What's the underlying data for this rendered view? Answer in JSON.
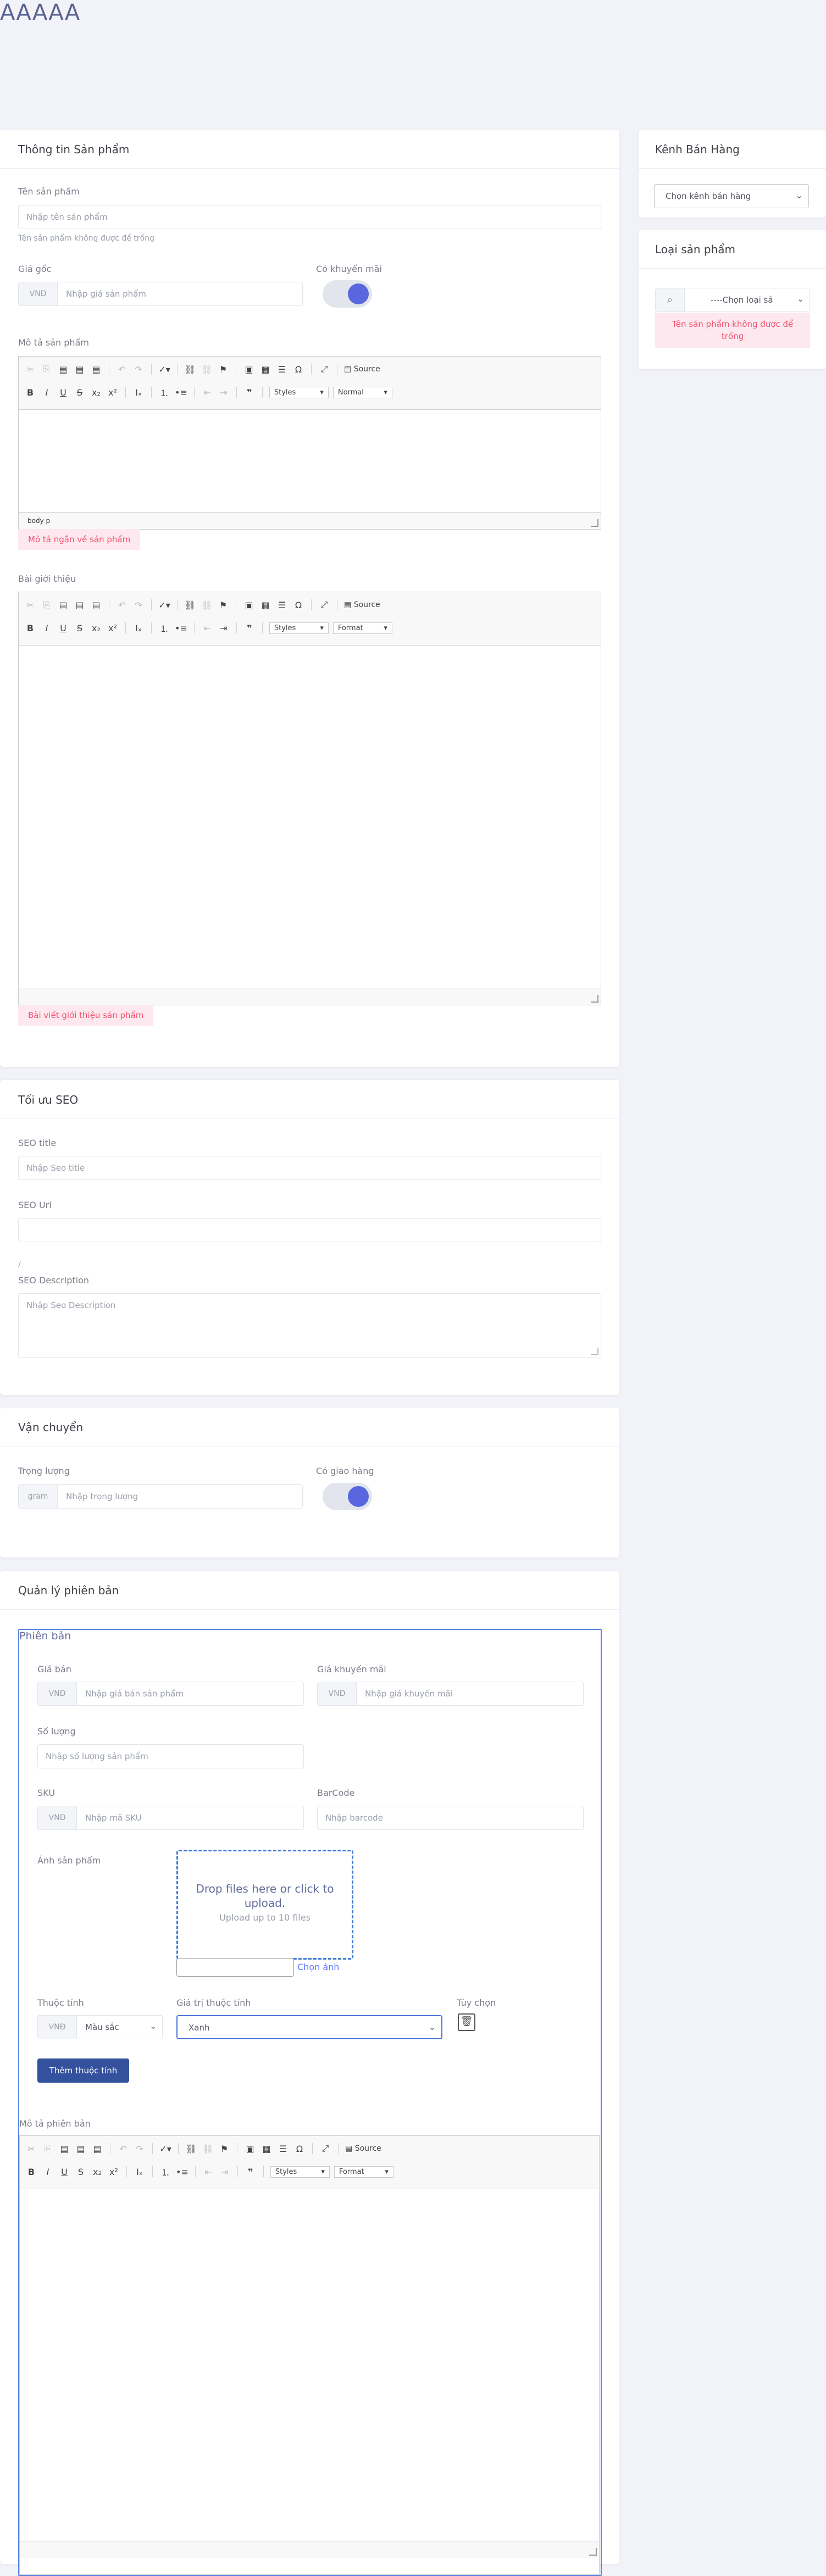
{
  "page": {
    "title": "AAAAA"
  },
  "product_info": {
    "title": "Thông tin Sản phẩm",
    "name_label": "Tên sản phẩm",
    "name_placeholder": "Nhập tên sản phẩm",
    "name_hint": "Tên sản phẩm không được để trống",
    "price_label": "Giá gốc",
    "price_prefix": "VNĐ",
    "price_placeholder": "Nhập giá sản phẩm",
    "promo_label": "Có khuyến mãi",
    "promo_enabled": true,
    "desc_label": "Mô tả sản phẩm",
    "desc_error": "Mô tả ngắn về sản phẩm",
    "desc_path": "body  p",
    "intro_label": "Bài giới thiệu",
    "intro_error": "Bài viết giới thiệu sản phẩm"
  },
  "editor_toolbar": {
    "styles": "Styles",
    "normal": "Normal",
    "format": "Format",
    "source": "Source",
    "row1_icons": [
      "cut-icon",
      "copy-icon",
      "paste-icon",
      "paste-text-icon",
      "paste-word-icon",
      "undo-icon",
      "redo-icon",
      "spellcheck-icon",
      "link-icon",
      "unlink-icon",
      "anchor-icon",
      "image-icon",
      "table-icon",
      "hr-icon",
      "special-char-icon",
      "maximize-icon",
      "source-icon"
    ],
    "row2_icons": [
      "bold-icon",
      "italic-icon",
      "underline-icon",
      "strike-icon",
      "subscript-icon",
      "superscript-icon",
      "remove-format-icon",
      "numbered-list-icon",
      "bulleted-list-icon",
      "outdent-icon",
      "indent-icon",
      "blockquote-icon"
    ]
  },
  "seo": {
    "title": "Tối ưu SEO",
    "seo_title_label": "SEO title",
    "seo_title_placeholder": "Nhập Seo title",
    "seo_url_label": "SEO Url",
    "seo_url_value": "",
    "seo_url_slash": "/",
    "seo_desc_label": "SEO Description",
    "seo_desc_placeholder": "Nhập Seo Description"
  },
  "shipping": {
    "title": "Vận chuyển",
    "weight_label": "Trọng lượng",
    "weight_prefix": "gram",
    "weight_placeholder": "Nhập trọng lượng",
    "delivery_label": "Có giao hàng",
    "delivery_enabled": true
  },
  "versions": {
    "title": "Quản lý phiên bản",
    "box_title": "Phiên bản",
    "sale_price_label": "Giá bán",
    "sale_price_prefix": "VNĐ",
    "sale_price_placeholder": "Nhập giá bán sản phẩm",
    "promo_price_label": "Giá khuyến mãi",
    "promo_price_prefix": "VNĐ",
    "promo_price_placeholder": "Nhập giá khuyến mãi",
    "qty_label": "Số lượng",
    "qty_placeholder": "Nhập số lượng sản phẩm",
    "sku_label": "SKU",
    "sku_prefix": "VNĐ",
    "sku_placeholder": "Nhập mã SKU",
    "barcode_label": "BarCode",
    "barcode_placeholder": "Nhập barcode",
    "image_label": "Ảnh sản phẩm",
    "dropzone_title": "Drop files here or click to upload.",
    "dropzone_sub": "Upload up to 10 files",
    "choose_image": "Chọn ảnh",
    "attr_label": "Thuộc tính",
    "attr_prefix": "VNĐ",
    "attr_value": "Màu sắc",
    "attr_val_label": "Giá trị thuộc tính",
    "attr_val_value": "Xanh",
    "option_label": "Tùy chọn",
    "add_attr_button": "Thêm thuộc tính",
    "version_desc_label": "Mô tả phiên bản"
  },
  "sales_channel": {
    "title": "Kênh Bán Hàng",
    "select_value": "Chọn kênh bán hàng"
  },
  "product_type": {
    "title": "Loại sản phẩm",
    "select_value": "----Chọn loại sả",
    "error": "Tên sản phẩm không được để trống"
  },
  "colors": {
    "accent": "#5867dd",
    "error": "#f4516c",
    "primary_button": "#34519d"
  }
}
